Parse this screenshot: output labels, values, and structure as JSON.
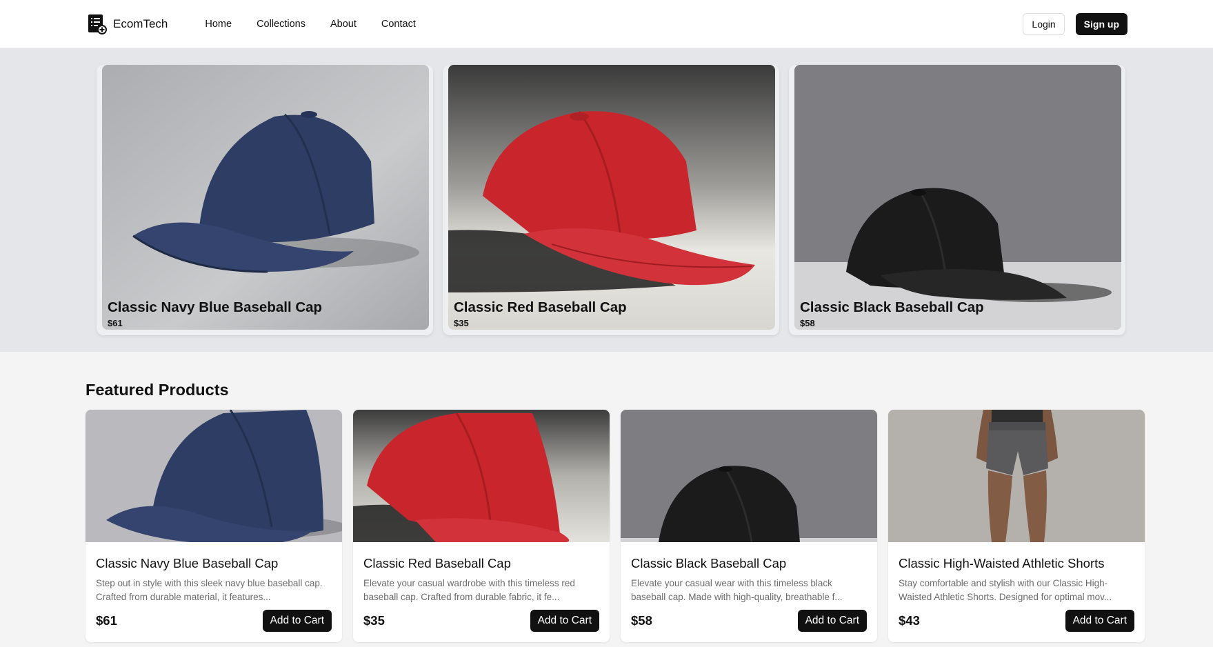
{
  "header": {
    "brand": "EcomTech",
    "nav": [
      "Home",
      "Collections",
      "About",
      "Contact"
    ],
    "login_label": "Login",
    "signup_label": "Sign up"
  },
  "hero": {
    "slides": [
      {
        "title": "Classic Navy Blue Baseball Cap",
        "price": "$61"
      },
      {
        "title": "Classic Red Baseball Cap",
        "price": "$35"
      },
      {
        "title": "Classic Black Baseball Cap",
        "price": "$58"
      }
    ]
  },
  "featured": {
    "title": "Featured Products",
    "products": [
      {
        "title": "Classic Navy Blue Baseball Cap",
        "description": "Step out in style with this sleek navy blue baseball cap. Crafted from durable material, it features...",
        "price": "$61",
        "button": "Add to Cart"
      },
      {
        "title": "Classic Red Baseball Cap",
        "description": "Elevate your casual wardrobe with this timeless red baseball cap. Crafted from durable fabric, it fe...",
        "price": "$35",
        "button": "Add to Cart"
      },
      {
        "title": "Classic Black Baseball Cap",
        "description": "Elevate your casual wear with this timeless black baseball cap. Made with high-quality, breathable f...",
        "price": "$58",
        "button": "Add to Cart"
      },
      {
        "title": "Classic High-Waisted Athletic Shorts",
        "description": "Stay comfortable and stylish with our Classic High-Waisted Athletic Shorts. Designed for optimal mov...",
        "price": "$43",
        "button": "Add to Cart"
      }
    ]
  },
  "colors": {
    "navy_cap": "#2e3d64",
    "red_cap": "#c8262c",
    "black_cap": "#1b1b1b",
    "shorts": "#5a5a5c",
    "button": "#111111"
  }
}
